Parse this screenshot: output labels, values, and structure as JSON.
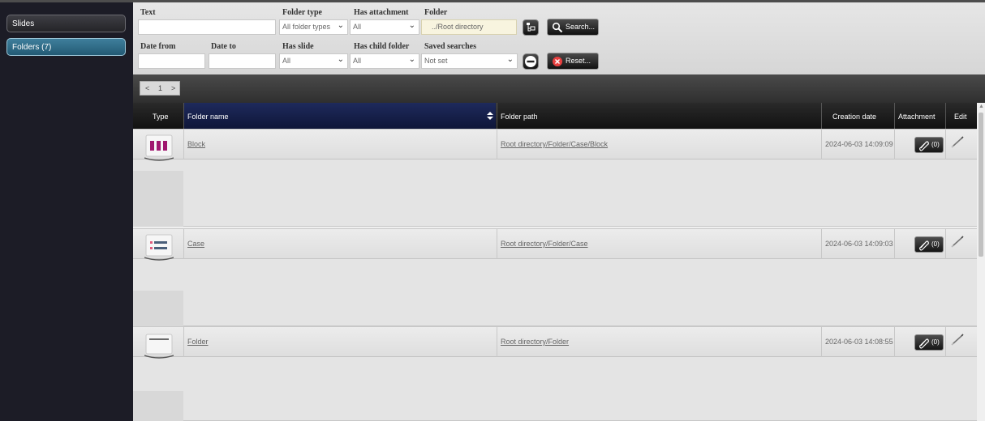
{
  "sidebar": {
    "slides_label": "Slides",
    "folders_label": "Folders (7)"
  },
  "filters": {
    "text_label": "Text",
    "text_value": "",
    "folder_type_label": "Folder type",
    "folder_type_value": "All folder types",
    "has_attachment_label": "Has attachment",
    "has_attachment_value": "All",
    "folder_label": "Folder",
    "folder_value": "../Root directory",
    "search_label": "Search...",
    "date_from_label": "Date from",
    "date_from_value": "",
    "date_to_label": "Date to",
    "date_to_value": "",
    "has_slide_label": "Has slide",
    "has_slide_value": "All",
    "has_child_folder_label": "Has child folder",
    "has_child_folder_value": "All",
    "saved_searches_label": "Saved searches",
    "saved_searches_value": "Not set",
    "reset_label": "Reset..."
  },
  "pager": {
    "prev": "<",
    "page": "1",
    "next": ">"
  },
  "grid": {
    "columns": {
      "type": "Type",
      "folder_name": "Folder name",
      "folder_path": "Folder path",
      "creation_date": "Creation date",
      "attachment": "Attachment",
      "edit": "Edit"
    },
    "rows": [
      {
        "name": "Block",
        "path": "Root directory/Folder/Case/Block",
        "date": "2024-06-03 14:09:09",
        "attachments": "(0)",
        "icon": "block-icon"
      },
      {
        "name": "Case",
        "path": "Root directory/Folder/Case",
        "date": "2024-06-03 14:09:03",
        "attachments": "(0)",
        "icon": "case-icon"
      },
      {
        "name": "Folder",
        "path": "Root directory/Folder",
        "date": "2024-06-03 14:08:55",
        "attachments": "(0)",
        "icon": "folder-icon"
      }
    ]
  },
  "colors": {
    "sidebar_bg": "#1c1c26",
    "active_nav": "#2f6d8a",
    "header_dark": "#111111",
    "sorted_header": "#1e2a5c",
    "block_icon": "#a0166e"
  }
}
